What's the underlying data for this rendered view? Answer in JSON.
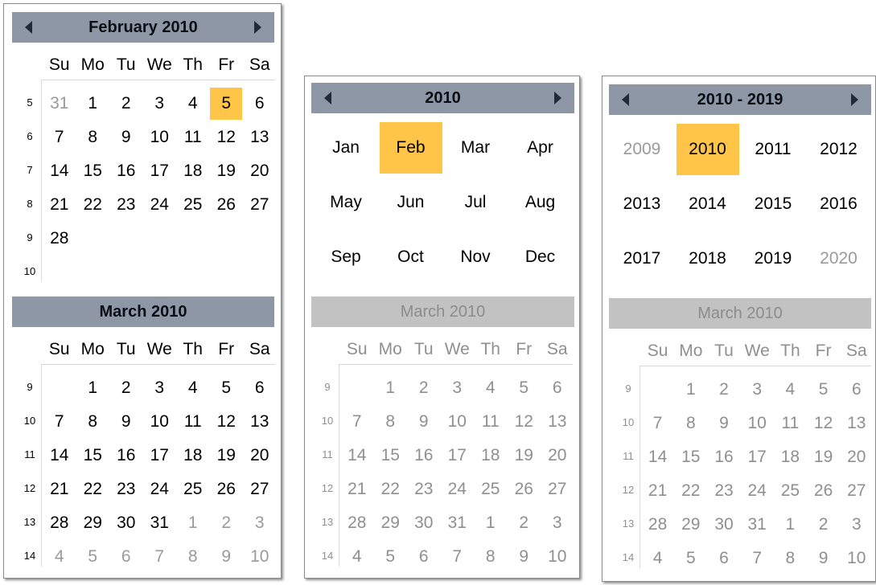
{
  "feb": {
    "title": "February 2010",
    "dow": [
      "Su",
      "Mo",
      "Tu",
      "We",
      "Th",
      "Fr",
      "Sa"
    ],
    "weeks": [
      "5",
      "6",
      "7",
      "8",
      "9",
      "10"
    ],
    "days": [
      [
        "31",
        "1",
        "2",
        "3",
        "4",
        "5",
        "6"
      ],
      [
        "7",
        "8",
        "9",
        "10",
        "11",
        "12",
        "13"
      ],
      [
        "14",
        "15",
        "16",
        "17",
        "18",
        "19",
        "20"
      ],
      [
        "21",
        "22",
        "23",
        "24",
        "25",
        "26",
        "27"
      ],
      [
        "28",
        "",
        "",
        "",
        "",
        "",
        ""
      ]
    ],
    "selected": "5"
  },
  "mar": {
    "title": "March 2010",
    "dow": [
      "Su",
      "Mo",
      "Tu",
      "We",
      "Th",
      "Fr",
      "Sa"
    ],
    "weeks": [
      "9",
      "10",
      "11",
      "12",
      "13",
      "14"
    ],
    "days": [
      [
        "",
        "1",
        "2",
        "3",
        "4",
        "5",
        "6"
      ],
      [
        "7",
        "8",
        "9",
        "10",
        "11",
        "12",
        "13"
      ],
      [
        "14",
        "15",
        "16",
        "17",
        "18",
        "19",
        "20"
      ],
      [
        "21",
        "22",
        "23",
        "24",
        "25",
        "26",
        "27"
      ],
      [
        "28",
        "29",
        "30",
        "31",
        "1",
        "2",
        "3"
      ],
      [
        "4",
        "5",
        "6",
        "7",
        "8",
        "9",
        "10"
      ]
    ]
  },
  "year": {
    "title": "2010",
    "months": [
      "Jan",
      "Feb",
      "Mar",
      "Apr",
      "May",
      "Jun",
      "Jul",
      "Aug",
      "Sep",
      "Oct",
      "Nov",
      "Dec"
    ],
    "selected": "Feb"
  },
  "decade": {
    "title": "2010 - 2019",
    "years": [
      "2009",
      "2010",
      "2011",
      "2012",
      "2013",
      "2014",
      "2015",
      "2016",
      "2017",
      "2018",
      "2019",
      "2020"
    ],
    "selected": "2010"
  },
  "colors": {
    "header": "#8e97a6",
    "selection": "#ffc548",
    "dimmed_header": "#c2c2c2"
  },
  "icons": {
    "prev": "triangle-left-icon",
    "next": "triangle-right-icon"
  }
}
